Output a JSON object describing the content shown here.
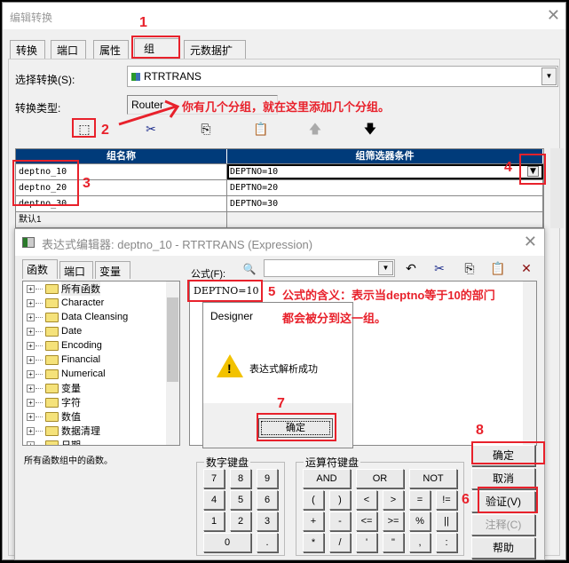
{
  "window": {
    "title": "编辑转换",
    "tabs": [
      "转换",
      "端口",
      "属性",
      "组",
      "元数据扩展"
    ],
    "select_transform_label": "选择转换(S):",
    "select_transform_value": "RTRTRANS",
    "transform_type_label": "转换类型:",
    "transform_type_value": "Router",
    "grid": {
      "headers": [
        "组名称",
        "组筛选器条件"
      ],
      "rows": [
        {
          "name": "deptno_10",
          "condition": "DEPTNO=10"
        },
        {
          "name": "deptno_20",
          "condition": "DEPTNO=20"
        },
        {
          "name": "deptno_30",
          "condition": "DEPTNO=30"
        },
        {
          "name": "默认1",
          "condition": ""
        }
      ]
    }
  },
  "expression_editor": {
    "title": "表达式编辑器: deptno_10 - RTRTRANS (Expression)",
    "tabs": [
      "函数",
      "端口",
      "变量"
    ],
    "tree_items": [
      "所有函数",
      "Character",
      "Data Cleansing",
      "Date",
      "Encoding",
      "Financial",
      "Numerical",
      "变量",
      "字符",
      "数值",
      "数据清理",
      "日期"
    ],
    "tree_description": "所有函数组中的函数。",
    "formula_label": "公式(F):",
    "formula_value": "DEPTNO=10",
    "numpad_title": "数字键盘",
    "numpad_keys": [
      "7",
      "8",
      "9",
      "4",
      "5",
      "6",
      "1",
      "2",
      "3",
      "0",
      "."
    ],
    "operator_title": "运算符键盘",
    "operator_keys": [
      "AND",
      "OR",
      "NOT",
      "(",
      ")",
      "<",
      ">",
      "=",
      "!=",
      "+",
      "-",
      "<=",
      ">=",
      "%",
      "||",
      "*",
      "/",
      "'",
      "\"",
      ",",
      ":"
    ],
    "buttons": {
      "ok": "确定",
      "cancel": "取消",
      "validate": "验证(V)",
      "comment": "注释(C)",
      "help": "帮助"
    }
  },
  "message_box": {
    "title": "Designer",
    "message": "表达式解析成功",
    "ok": "确定"
  },
  "annotations": {
    "n1": "1",
    "n2": "2",
    "n3": "3",
    "n4": "4",
    "n5": "5",
    "n6": "6",
    "n7": "7",
    "n8": "8",
    "hint2": "你有几个分组，就在这里添加几个分组。",
    "hint5_line1": "公式的含义：表示当deptno等于10的部门",
    "hint5_line2": "都会被分到这一组。"
  },
  "colors": {
    "annotation": "#e8212b",
    "grid_header": "#003b7a"
  }
}
